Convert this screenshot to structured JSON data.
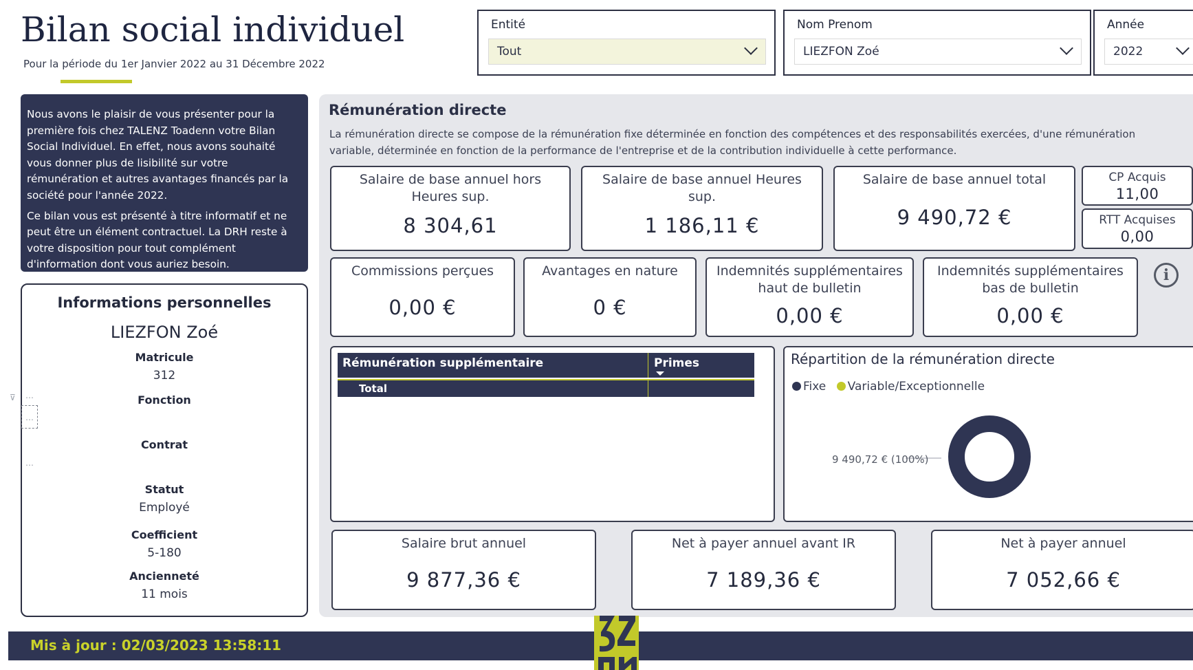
{
  "header": {
    "title": "Bilan social individuel",
    "subtitle": "Pour la période du 1er Janvier 2022 au 31 Décembre 2022"
  },
  "filters": {
    "entite": {
      "label": "Entité",
      "value": "Tout"
    },
    "nom": {
      "label": "Nom Prenom",
      "value": "LIEZFON Zoé"
    },
    "annee": {
      "label": "Année",
      "value": "2022"
    }
  },
  "intro": {
    "p1": "Nous avons le plaisir de vous présenter pour la première fois chez TALENZ Toadenn votre Bilan Social Individuel. En effet, nous avons souhaité vous donner plus de lisibilité sur votre rémunération et autres avantages financés par la société pour l'année 2022.",
    "p2": "Ce bilan vous est présenté à titre informatif et ne peut être un élément contractuel. La DRH reste à votre disposition pour tout complément d'information dont vous auriez besoin."
  },
  "personal": {
    "title": "Informations personnelles",
    "name": "LIEZFON Zoé",
    "matricule_label": "Matricule",
    "matricule": "312",
    "fonction_label": "Fonction",
    "contrat_label": "Contrat",
    "statut_label": "Statut",
    "statut": "Employé",
    "coefficient_label": "Coefficient",
    "coefficient": "5-180",
    "anciennete_label": "Ancienneté",
    "anciennete": "11 mois"
  },
  "remuneration": {
    "title": "Rémunération directe",
    "description": "La rémunération directe se compose de la rémunération fixe déterminée en fonction des compétences et des responsabilités exercées, d'une rémunération variable, déterminée en fonction de la performance de l'entreprise et de la contribution individuelle à cette performance."
  },
  "cards": {
    "base_hors_hs": {
      "label": "Salaire de base annuel hors Heures sup.",
      "value": "8 304,61"
    },
    "base_hs": {
      "label": "Salaire de base annuel Heures sup.",
      "value": "1 186,11 €"
    },
    "base_total": {
      "label": "Salaire de base annuel total",
      "value": "9 490,72 €"
    },
    "cp": {
      "label": "CP Acquis",
      "value": "11,00"
    },
    "rtt": {
      "label": "RTT Acquises",
      "value": "0,00"
    },
    "commissions": {
      "label": "Commissions perçues",
      "value": "0,00 €"
    },
    "avantages": {
      "label": "Avantages en nature",
      "value": "0 €"
    },
    "indem_haut": {
      "label": "Indemnités supplémentaires haut de bulletin",
      "value": "0,00 €"
    },
    "indem_bas": {
      "label": "Indemnités supplémentaires bas de bulletin",
      "value": "0,00 €"
    },
    "brut": {
      "label": "Salaire brut annuel",
      "value": "9 877,36 €"
    },
    "net_avant_ir": {
      "label": "Net à payer annuel avant IR",
      "value": "7 189,36 €"
    },
    "net": {
      "label": "Net à payer annuel",
      "value": "7 052,66 €"
    }
  },
  "table": {
    "col1": "Rémunération supplémentaire",
    "col2": "Primes",
    "total": "Total"
  },
  "chart_data": {
    "type": "pie",
    "title": "Répartition de la rémunération directe",
    "legend": [
      "Fixe",
      "Variable/Exceptionnelle"
    ],
    "colors": [
      "#2f3553",
      "#c2c92a"
    ],
    "values": [
      9490.72,
      0
    ],
    "data_label": "9 490,72 € (100%)"
  },
  "footer": {
    "updated": "Mis à jour :  02/03/2023 13:58:11"
  },
  "colors": {
    "navy": "#2f3553",
    "accent": "#c2c92a"
  }
}
